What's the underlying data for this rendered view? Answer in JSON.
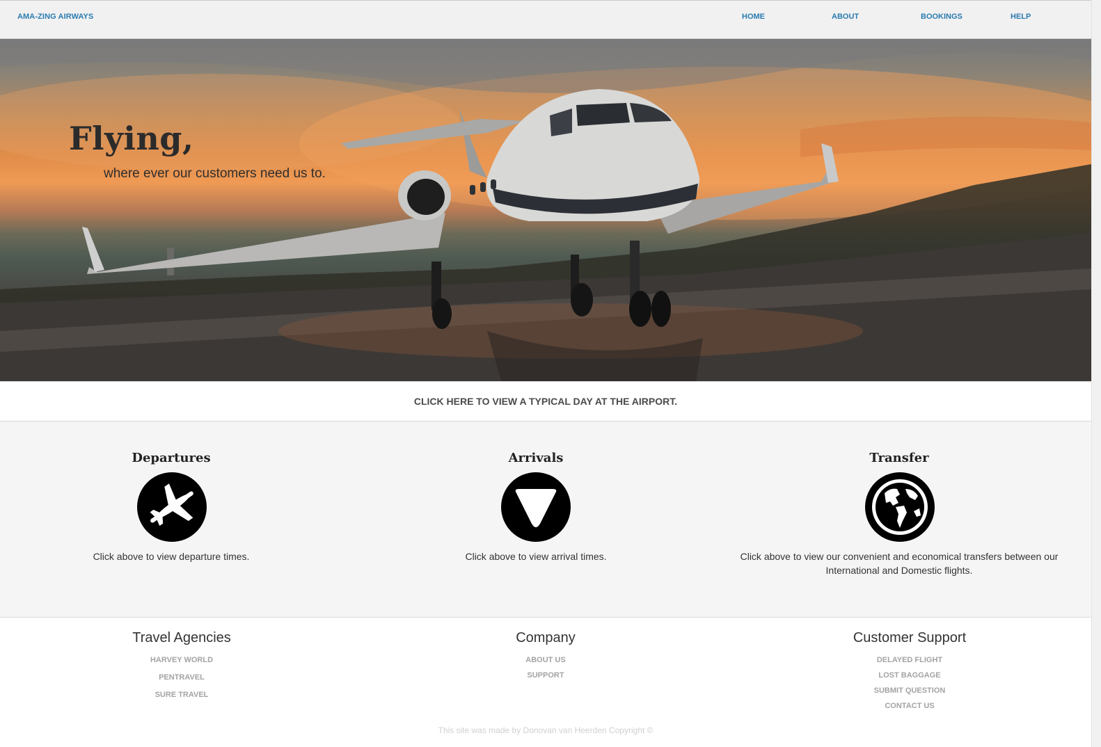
{
  "navbar": {
    "brand": "AMA-ZING AIRWAYS",
    "links": [
      {
        "label": "HOME"
      },
      {
        "label": "ABOUT"
      },
      {
        "label": "BOOKINGS"
      },
      {
        "label": "HELP"
      }
    ]
  },
  "hero": {
    "title": "Flying,",
    "subtitle": "where ever our customers need us to."
  },
  "cta": {
    "label": "CLICK HERE TO VIEW A TYPICAL DAY AT THE AIRPORT."
  },
  "features": [
    {
      "title": "Departures",
      "icon": "airplane-icon",
      "description": "Click above to view departure times."
    },
    {
      "title": "Arrivals",
      "icon": "triangle-down-icon",
      "description": "Click above to view arrival times."
    },
    {
      "title": "Transfer",
      "icon": "globe-icon",
      "description": "Click above to view our convenient and economical transfers between our International and Domestic flights."
    }
  ],
  "footer": {
    "columns": [
      {
        "title": "Travel Agencies",
        "links": [
          "HARVEY WORLD",
          "PENTRAVEL",
          "SURE TRAVEL"
        ]
      },
      {
        "title": "Company",
        "links": [
          "ABOUT US",
          "SUPPORT"
        ]
      },
      {
        "title": "Customer Support",
        "links": [
          "DELAYED FLIGHT",
          "LOST BAGGAGE",
          "SUBMIT QUESTION",
          "CONTACT US"
        ]
      }
    ],
    "credit": "This site was made by Donovan van Heerden Copyright ©"
  },
  "colors": {
    "link_blue": "#2a7bb0",
    "footer_link_grey": "#a3a3a3",
    "features_bg": "#f5f5f5"
  }
}
